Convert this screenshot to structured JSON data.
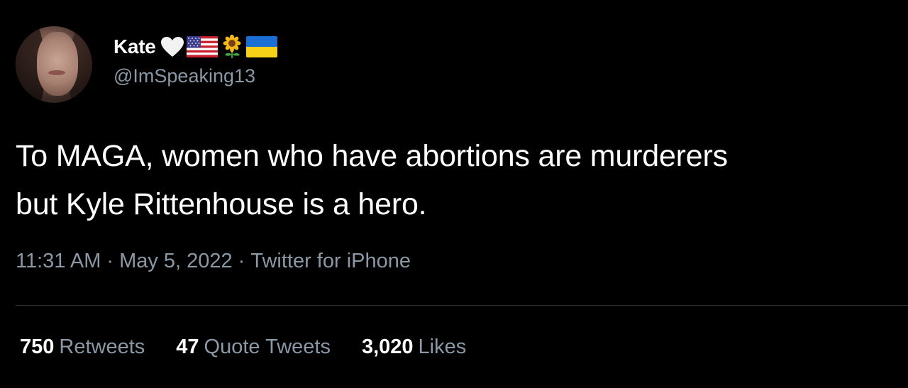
{
  "user": {
    "display_name": "Kate",
    "handle": "@ImSpeaking13",
    "name_emojis": [
      "white-heart-icon",
      "us-flag-icon",
      "sunflower-icon",
      "ukraine-flag-icon"
    ]
  },
  "tweet": {
    "text_line1": "To MAGA, women who have abortions are murderers",
    "text_line2": "but Kyle Rittenhouse is a hero.",
    "time": "11:31 AM",
    "date": "May 5, 2022",
    "source": "Twitter for iPhone",
    "separator": "·"
  },
  "stats": [
    {
      "count": "750",
      "label": "Retweets"
    },
    {
      "count": "47",
      "label": "Quote Tweets"
    },
    {
      "count": "3,020",
      "label": "Likes"
    }
  ],
  "colors": {
    "background": "#000000",
    "primary_text": "#ffffff",
    "secondary_text": "#8b98a5",
    "divider": "#2f3336"
  }
}
